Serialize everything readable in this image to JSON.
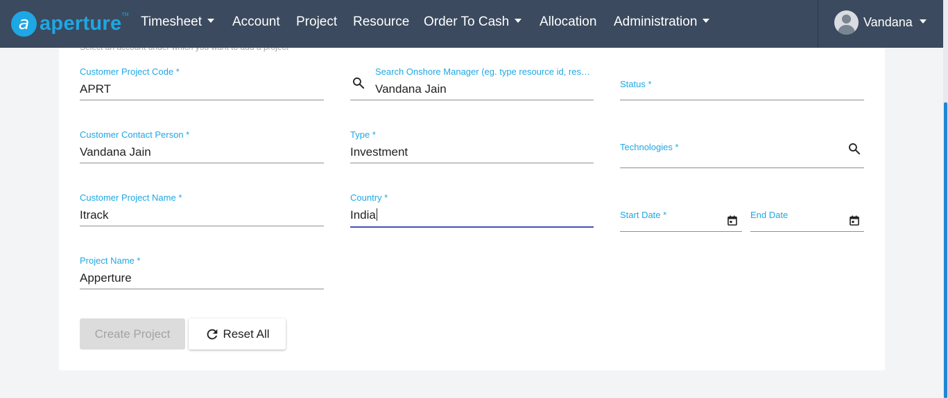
{
  "brand": {
    "logo_mark": "a",
    "name": "aperture",
    "tm": "TM"
  },
  "nav": {
    "timesheet": "Timesheet",
    "account": "Account",
    "project": "Project",
    "resource": "Resource",
    "order_to_cash": "Order To Cash",
    "allocation": "Allocation",
    "administration": "Administration"
  },
  "user": {
    "name": "Vandana"
  },
  "form": {
    "hint": "Select an account under which you want to add a project",
    "customer_project_code": {
      "label": "Customer Project Code *",
      "value": "APRT"
    },
    "onshore_manager": {
      "label": "Search Onshore Manager (eg. type resource id, res…",
      "value": "Vandana Jain"
    },
    "status": {
      "label": "Status *",
      "value": ""
    },
    "customer_contact_person": {
      "label": "Customer Contact Person *",
      "value": "Vandana Jain"
    },
    "type": {
      "label": "Type *",
      "value": "Investment"
    },
    "technologies": {
      "label": "Technologies *",
      "value": ""
    },
    "customer_project_name": {
      "label": "Customer Project Name *",
      "value": "Itrack"
    },
    "country": {
      "label": "Country *",
      "value": "India"
    },
    "start_date": {
      "label": "Start Date *",
      "value": ""
    },
    "end_date": {
      "label": "End Date",
      "value": ""
    },
    "project_name": {
      "label": "Project Name *",
      "value": "Apperture"
    }
  },
  "buttons": {
    "create": "Create Project",
    "reset": "Reset All"
  },
  "colors": {
    "navbar": "#3b4a5e",
    "accent": "#1ea7e4",
    "focus": "#3f51b5"
  }
}
